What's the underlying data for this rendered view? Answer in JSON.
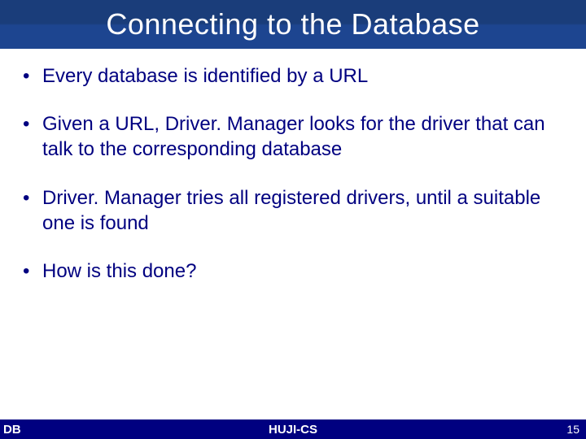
{
  "header": {
    "title": "Connecting to the Database"
  },
  "bullets": [
    {
      "text": "Every database is identified by a URL"
    },
    {
      "text": "Given a URL, Driver. Manager looks for the driver that can talk to the corresponding database"
    },
    {
      "text": "Driver. Manager tries all registered drivers, until a suitable one is found"
    },
    {
      "text": "How is this done?"
    }
  ],
  "footer": {
    "left": "DB",
    "center": "HUJI-CS",
    "page": "15"
  }
}
